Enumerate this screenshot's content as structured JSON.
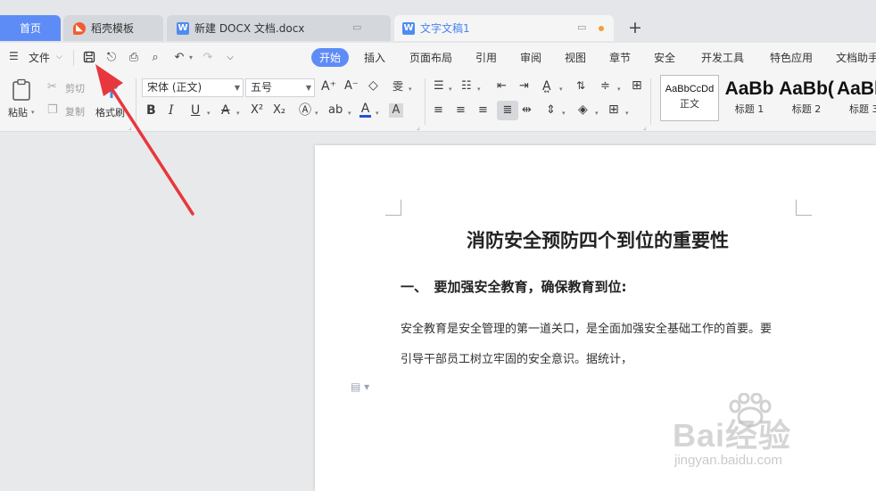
{
  "tabs": {
    "home": "首页",
    "template": "稻壳模板",
    "doc1": "新建 DOCX 文档.docx",
    "doc2": "文字文稿1",
    "new_tab": "+"
  },
  "file_menu": "文件",
  "menu": [
    "开始",
    "插入",
    "页面布局",
    "引用",
    "审阅",
    "视图",
    "章节",
    "安全",
    "开发工具",
    "特色应用",
    "文档助手"
  ],
  "clipboard": {
    "paste": "粘贴",
    "cut": "剪切",
    "copy": "复制",
    "format_painter": "格式刷"
  },
  "font": {
    "name": "宋体 (正文)",
    "size": "五号"
  },
  "styles": [
    {
      "sample": "AaBbCcDd",
      "label": "正文"
    },
    {
      "sample": "AaBb",
      "label": "标题 1"
    },
    {
      "sample": "AaBb(",
      "label": "标题 2"
    },
    {
      "sample": "AaBb",
      "label": "标题 3"
    }
  ],
  "document": {
    "title": "消防安全预防四个到位的重要性",
    "heading1": "一、　要加强安全教育，确保教育到位:",
    "para_line1": "安全教育是安全管理的第一道关口，是全面加强安全基础工作的首要。要",
    "para_line2": "引导干部员工树立牢固的安全意识。据统计，"
  },
  "watermark": {
    "text": "Bai经验",
    "sub": "jingyan.baidu.com"
  },
  "colors": {
    "accent": "#5e8cf7",
    "arrow": "#e8373c",
    "font_color_bar": "#2750d6"
  }
}
